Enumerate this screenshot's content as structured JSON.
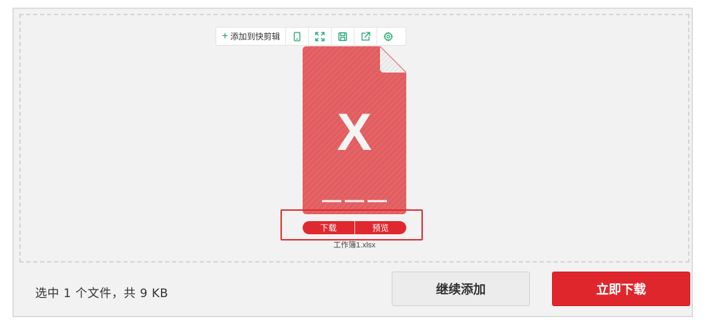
{
  "toolbar": {
    "add_label": "添加到快剪辑",
    "icons": [
      "tablet-icon",
      "fullscreen-icon",
      "save-icon",
      "share-icon",
      "settings-icon"
    ]
  },
  "file": {
    "name": "工作簿1.xlsx",
    "type_letter": "X",
    "download_label": "下载",
    "preview_label": "预览"
  },
  "footer": {
    "summary": "选中 1 个文件，共 9 KB",
    "continue_label": "继续添加",
    "download_now_label": "立即下载"
  },
  "colors": {
    "accent_green": "#1aa36b",
    "brand_red": "#e0262d",
    "file_red": "#e25d60"
  }
}
